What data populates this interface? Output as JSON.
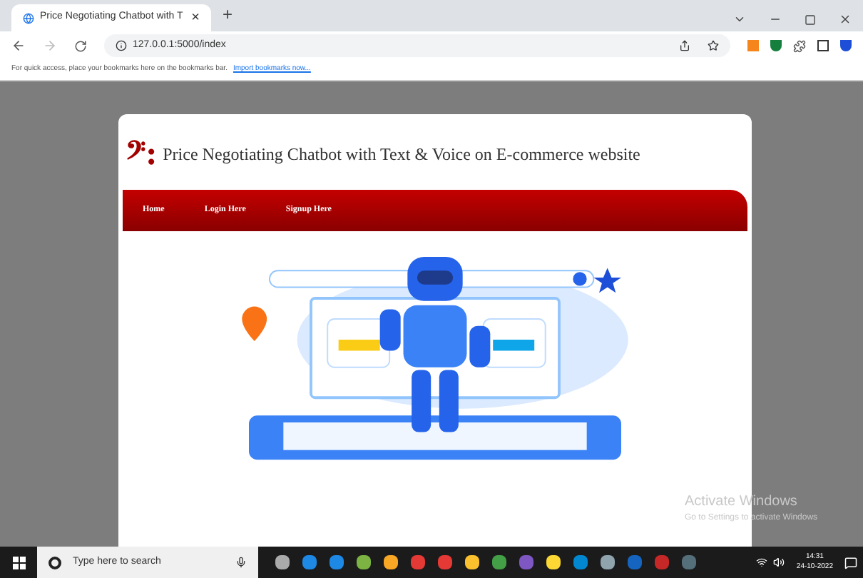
{
  "browser": {
    "tab_title": "Price Negotiating Chatbot with T",
    "tab_close": "×",
    "new_tab": "+",
    "url": "127.0.0.1:5000/index",
    "bookmarks_hint": "For quick access, place your bookmarks here on the bookmarks bar.",
    "bookmarks_link": "Import bookmarks now..."
  },
  "site": {
    "logo": "𝄢:",
    "title": "Price Negotiating Chatbot with Text & Voice on E-commerce website",
    "nav": [
      {
        "label": "Home"
      },
      {
        "label": "Login Here"
      },
      {
        "label": "Signup Here"
      }
    ]
  },
  "activation": {
    "title": "Activate Windows",
    "subtitle": "Go to Settings to activate Windows"
  },
  "taskbar": {
    "search_placeholder": "Type here to search",
    "time": "14:31",
    "date": "24-10-2022"
  }
}
